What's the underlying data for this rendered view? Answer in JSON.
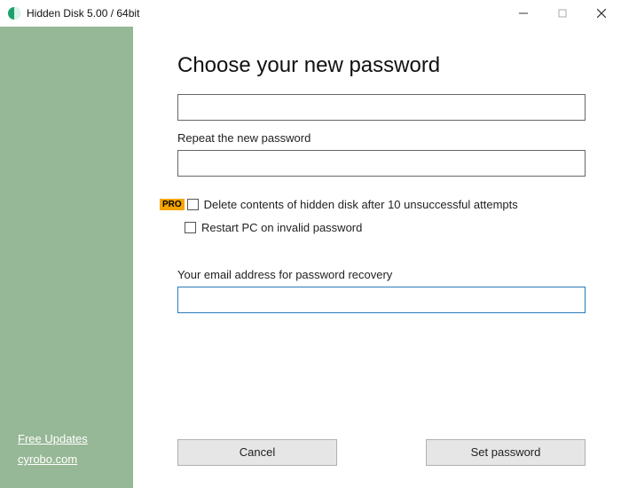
{
  "titlebar": {
    "title": "Hidden Disk 5.00 / 64bit"
  },
  "sidebar": {
    "link_updates": "Free Updates",
    "link_site": "cyrobo.com"
  },
  "main": {
    "heading": "Choose your new password",
    "password_value": "",
    "repeat_label": "Repeat the new password",
    "repeat_value": "",
    "pro_badge": "PRO",
    "opt_delete": "Delete contents of hidden disk after 10 unsuccessful attempts",
    "opt_restart": "Restart PC on invalid password",
    "recovery_label": "Your email address for password recovery",
    "recovery_value": ""
  },
  "buttons": {
    "cancel": "Cancel",
    "set": "Set password"
  }
}
